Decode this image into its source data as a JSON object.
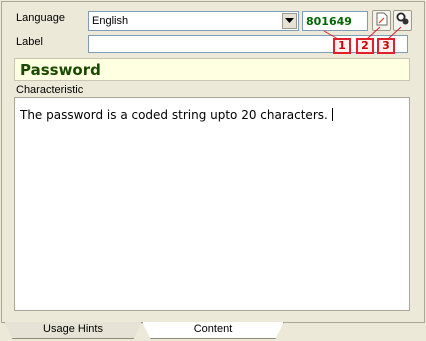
{
  "form": {
    "language_label": "Language",
    "language_value": "English",
    "code_value": "801649",
    "label_label": "Label",
    "label_value": "",
    "title_value": "Password",
    "characteristic_label": "Characteristic",
    "characteristic_text": "The password is a coded string upto 20 characters."
  },
  "callouts": [
    "1",
    "2",
    "3"
  ],
  "icons": {
    "dropdown": "chevron-down-icon",
    "document": "document-icon",
    "search": "search-icon"
  },
  "tabs": [
    {
      "label": "Usage Hints",
      "active": false
    },
    {
      "label": "Content",
      "active": true
    }
  ],
  "colors": {
    "callout_border": "#e0202a",
    "code_text": "#006600",
    "title_background": "#ffffe1",
    "title_text": "#1a4a00"
  }
}
